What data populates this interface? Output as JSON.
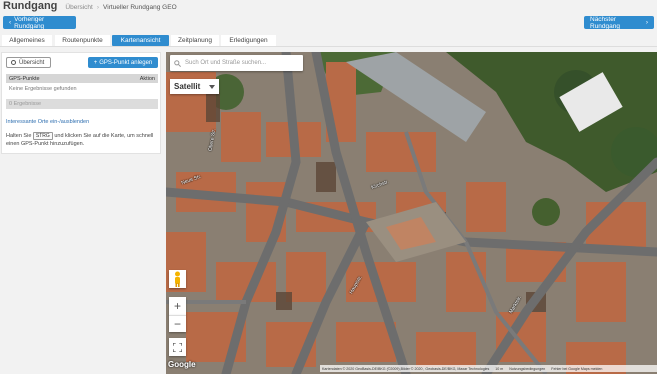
{
  "header": {
    "title": "Rundgang",
    "breadcrumb": [
      "Übersicht",
      "Virtueller Rundgang GEO"
    ],
    "breadcrumb_sep": "›",
    "prev_label": "Vorheriger Rundgang",
    "next_label": "Nächster Rundgang"
  },
  "tabs": [
    {
      "label": "Allgemeines",
      "active": false
    },
    {
      "label": "Routenpunkte",
      "active": false
    },
    {
      "label": "Kartenansicht",
      "active": true
    },
    {
      "label": "Zeitplanung",
      "active": false
    },
    {
      "label": "Erledigungen",
      "active": false
    }
  ],
  "panel": {
    "overview_label": "Übersicht",
    "add_gps_label": "GPS-Punkt anlegen",
    "col_points": "GPS-Punkte",
    "col_action": "Aktion",
    "empty_text": "Keine Ergebnisse gefunden",
    "results_text": "0 Ergebnisse",
    "toggle_link": "Interessante Orte ein-/ausblenden",
    "help_before": "Halten Sie",
    "help_key": "STRG",
    "help_after": "und klicken Sie auf die Karte, um schnell einen GPS-Punkt hinzuzufügen."
  },
  "map": {
    "search_placeholder": "Such Ort und Straße suchen...",
    "map_type": "Satellit",
    "zoom_in": "+",
    "zoom_out": "−",
    "google": "Google",
    "attribution": [
      "Kartendaten © 2020 GeoBasis-DE/BKG (©2009),Bilder © 2020 , Geobasis-DE/BKG, Maxar Technologies",
      "10 m",
      "Nutzungsbedingungen",
      "Fehler bei Google Maps melden"
    ],
    "street_labels": [
      "Neue Str.",
      "Obere Str.",
      "Kirchstr.",
      "Marktstr.",
      "Hauptstr."
    ]
  },
  "colors": {
    "accent": "#2f8ccf",
    "roof": "#b86a47",
    "road": "#6d6d6d",
    "tree": "#3f5a2c"
  }
}
